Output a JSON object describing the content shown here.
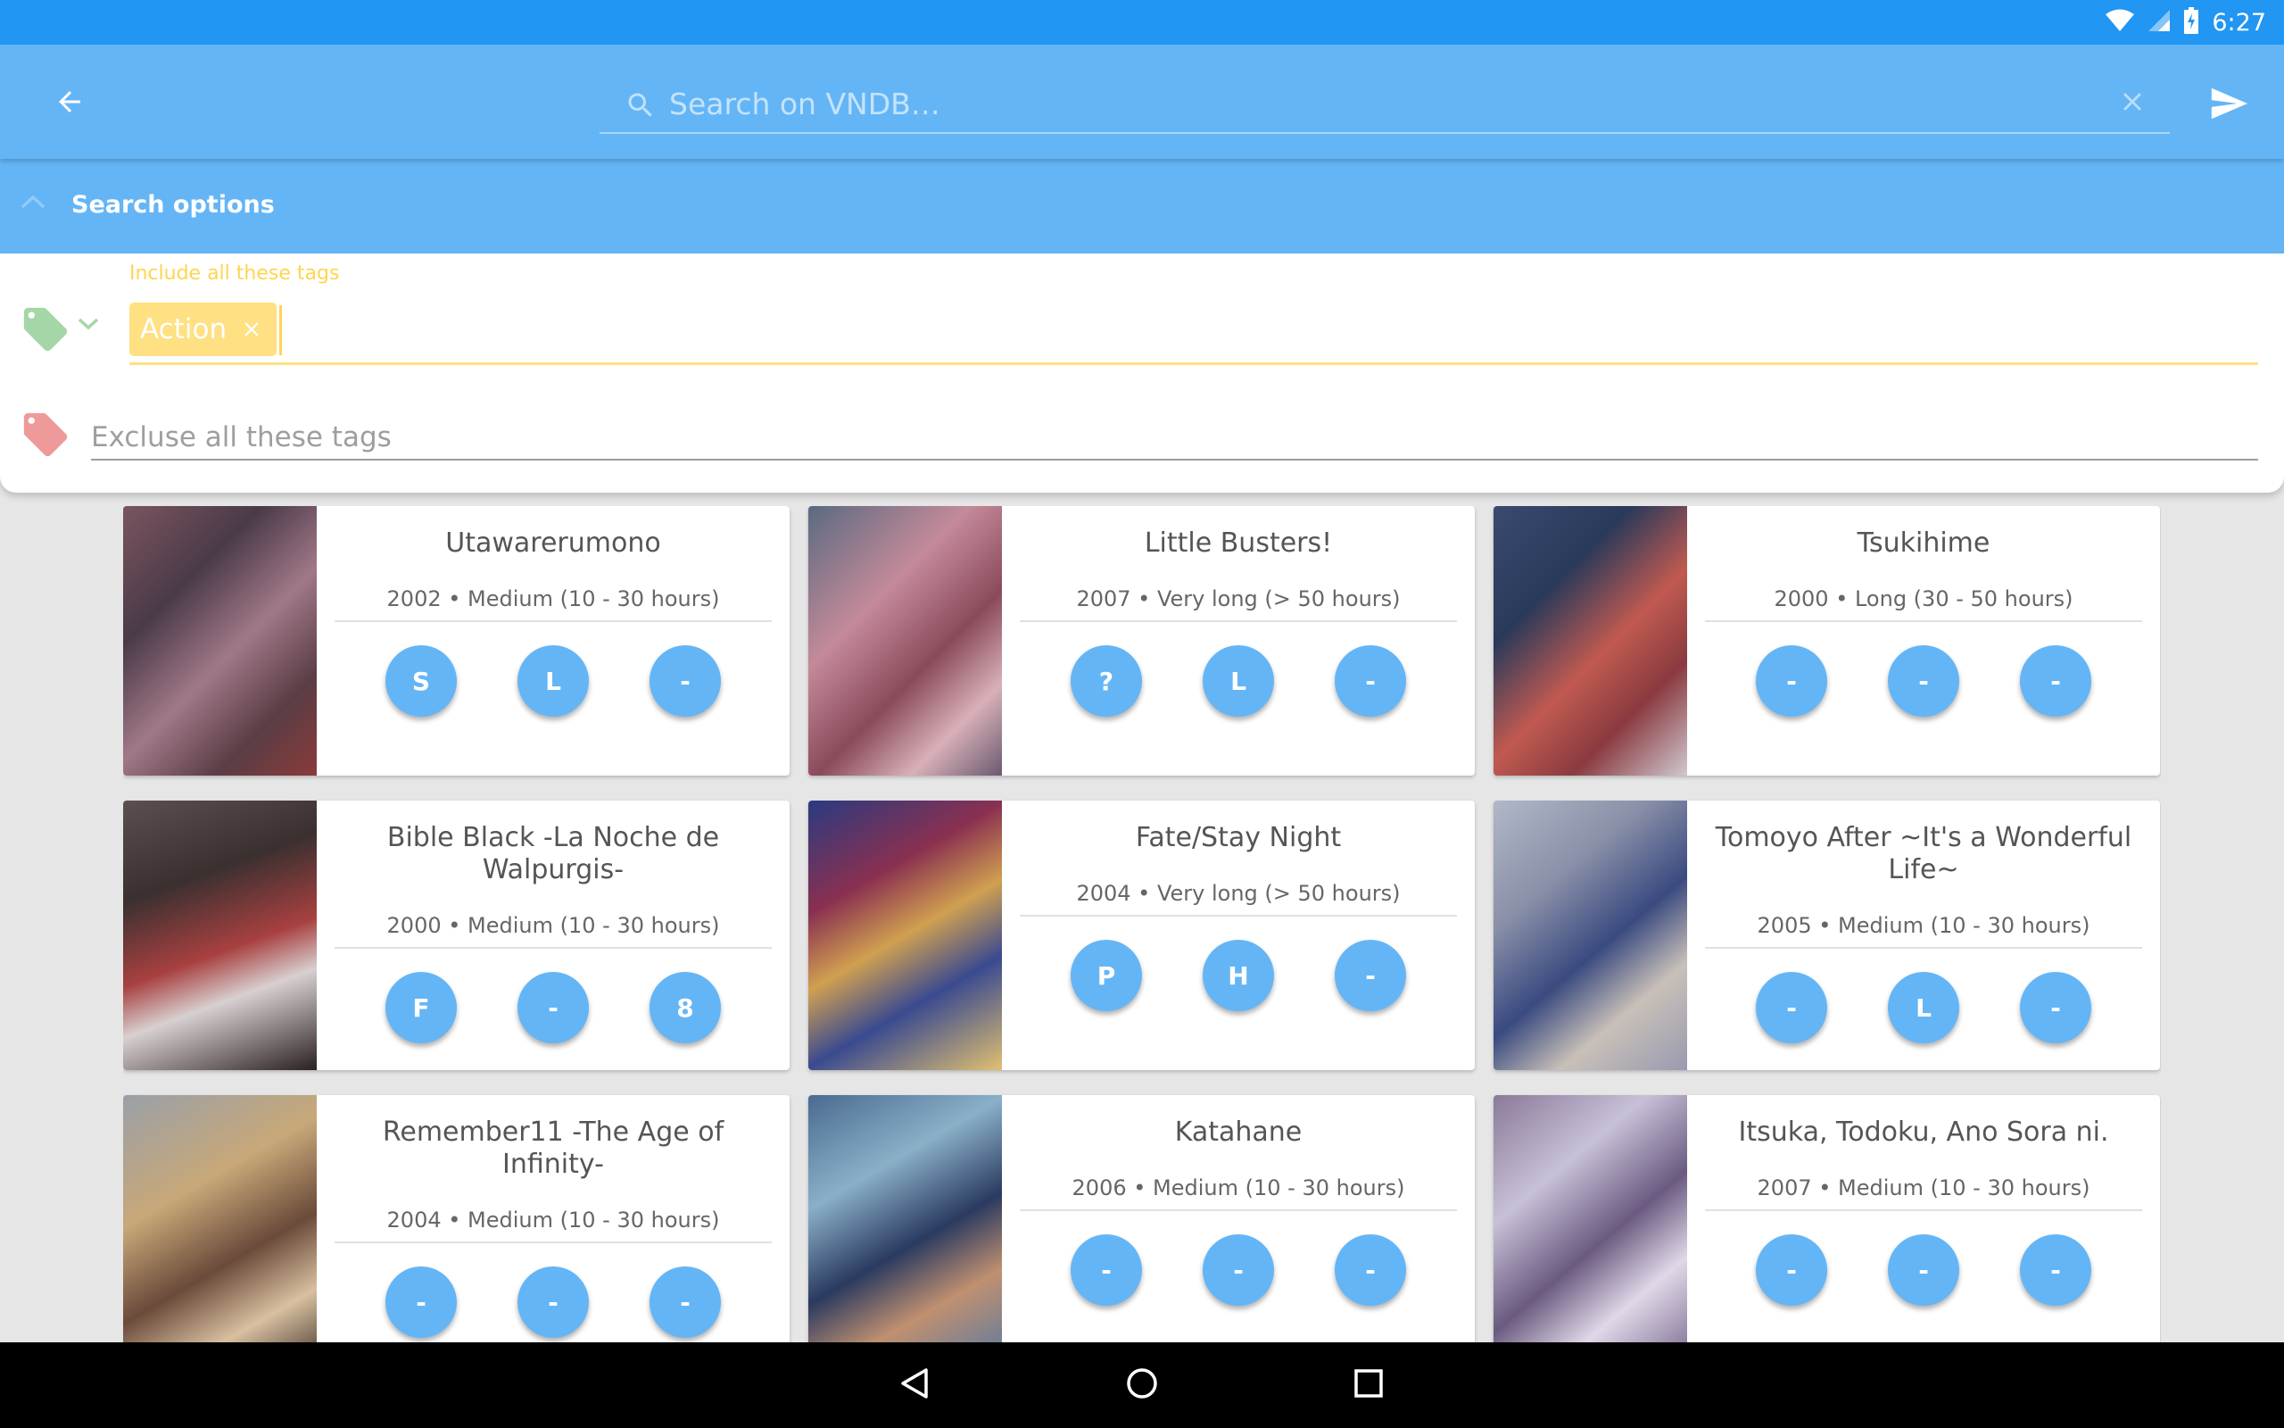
{
  "status_bar": {
    "time": "6:27"
  },
  "app_bar": {
    "search_placeholder": "Search on VNDB…",
    "search_value": ""
  },
  "search_options": {
    "label": "Search options",
    "include": {
      "label": "Include all these tags",
      "tags": [
        "Action"
      ]
    },
    "exclude": {
      "placeholder": "Excluse all these tags"
    }
  },
  "novels": [
    {
      "title": "Utawarerumono",
      "meta": "2002 • Medium (10 - 30 hours)",
      "statuses": [
        "S",
        "L",
        "-"
      ]
    },
    {
      "title": "Little Busters!",
      "meta": "2007 • Very long (> 50 hours)",
      "statuses": [
        "?",
        "L",
        "-"
      ]
    },
    {
      "title": "Tsukihime",
      "meta": "2000 • Long (30 - 50 hours)",
      "statuses": [
        "-",
        "-",
        "-"
      ]
    },
    {
      "title": "Bible Black -La Noche de Walpurgis-",
      "meta": "2000 • Medium (10 - 30 hours)",
      "statuses": [
        "F",
        "-",
        "8"
      ]
    },
    {
      "title": "Fate/Stay Night",
      "meta": "2004 • Very long (> 50 hours)",
      "statuses": [
        "P",
        "H",
        "-"
      ]
    },
    {
      "title": "Tomoyo After ~It's a Wonderful Life~",
      "meta": "2005 • Medium (10 - 30 hours)",
      "statuses": [
        "-",
        "L",
        "-"
      ]
    },
    {
      "title": "Remember11 -The Age of Infinity-",
      "meta": "2004 • Medium (10 - 30 hours)",
      "statuses": [
        "-",
        "-",
        "-"
      ]
    },
    {
      "title": "Katahane",
      "meta": "2006 • Medium (10 - 30 hours)",
      "statuses": [
        "-",
        "-",
        "-"
      ]
    },
    {
      "title": "Itsuka, Todoku, Ano Sora ni.",
      "meta": "2007 • Medium (10 - 30 hours)",
      "statuses": [
        "-",
        "-",
        "-"
      ]
    }
  ],
  "colors": {
    "status_bar": "#2196F3",
    "app_bar": "#64B5F6",
    "include_tag": "#FFE082",
    "include_icon": "#A5D6A7",
    "exclude_icon": "#EF9A9A"
  },
  "icons": {
    "back": "arrow-left-icon",
    "search": "search-icon",
    "clear": "close-icon",
    "send": "send-icon",
    "include": "tag-icon",
    "exclude": "tag-icon",
    "nav": [
      "back-triangle-icon",
      "home-circle-icon",
      "recents-square-icon"
    ]
  }
}
